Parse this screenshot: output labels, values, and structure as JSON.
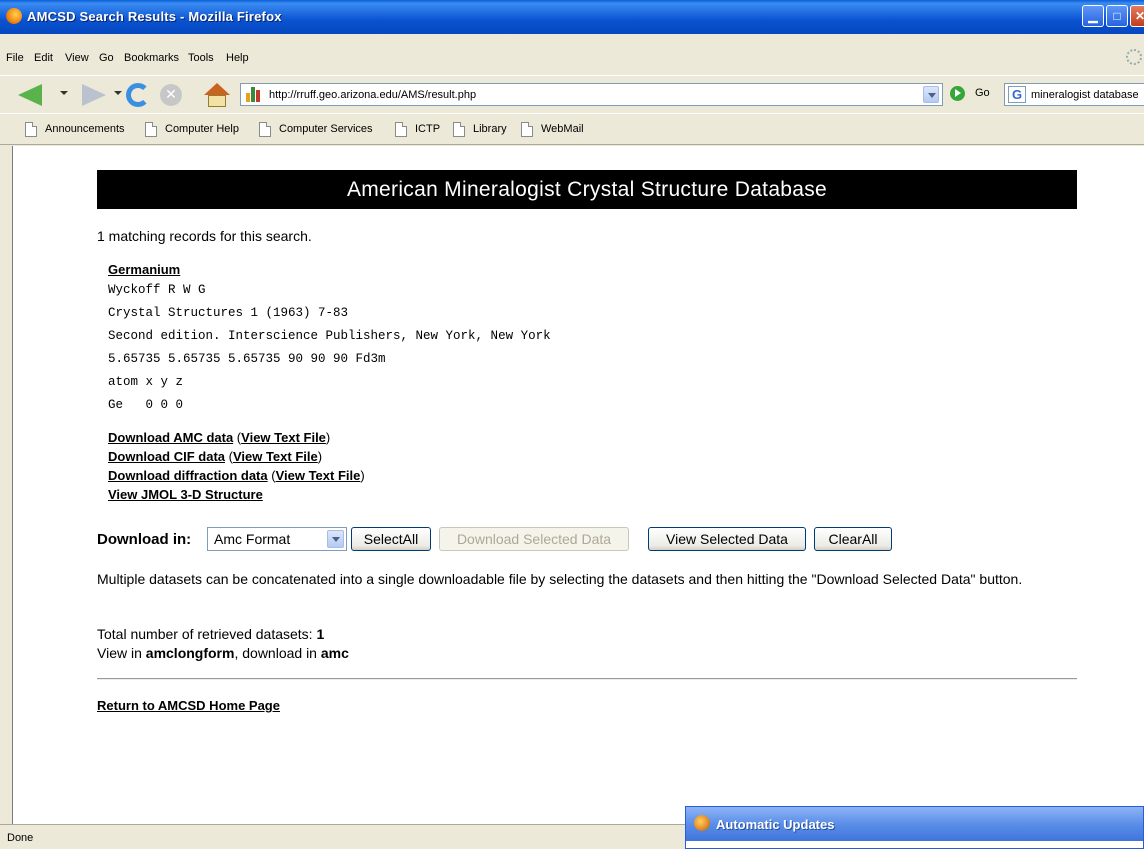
{
  "window": {
    "title": "AMCSD Search Results - Mozilla Firefox"
  },
  "menu": {
    "items": [
      "File",
      "Edit",
      "View",
      "Go",
      "Bookmarks",
      "Tools",
      "Help"
    ]
  },
  "navigation": {
    "url": "http://rruff.geo.arizona.edu/AMS/result.php",
    "go_label": "Go",
    "search_value": "mineralogist database"
  },
  "bookmarks": [
    "Announcements",
    "Computer Help",
    "Computer Services",
    "ICTP",
    "Library",
    "WebMail"
  ],
  "page": {
    "banner": "American Mineralogist Crystal Structure Database",
    "matching_text": "1 matching records for this search.",
    "record": {
      "mineral": "Germanium",
      "author": "Wyckoff R W G",
      "reference": "Crystal Structures 1 (1963) 7-83",
      "edition": "Second edition. Interscience Publishers, New York, New York",
      "cell": "5.65735 5.65735 5.65735 90 90 90 Fd3m",
      "atom_header": "atom x y z",
      "atom_row": "Ge   0 0 0"
    },
    "links": {
      "amc": "Download AMC data",
      "cif": "Download CIF data",
      "diffraction": "Download diffraction data",
      "view_text": "View Text File",
      "jmol": "View JMOL 3-D Structure"
    },
    "download": {
      "label": "Download in:",
      "format_selected": "Amc Format",
      "select_all": "SelectAll",
      "download_selected": "Download Selected Data",
      "view_selected": "View Selected Data",
      "clear_all": "ClearAll"
    },
    "multiple_text": "Multiple datasets can be concatenated into a single downloadable file by selecting the datasets and then hitting the \"Download Selected Data\" button.",
    "total_label": "Total number of retrieved datasets:",
    "total_value": "1",
    "view_in_label": "View in",
    "view_in_value": "amclongform",
    "download_in_label": ", download in",
    "download_in_value": "amc",
    "return_link": "Return to AMCSD Home Page"
  },
  "status": {
    "text": "Done"
  },
  "popup": {
    "title": "Automatic Updates"
  }
}
